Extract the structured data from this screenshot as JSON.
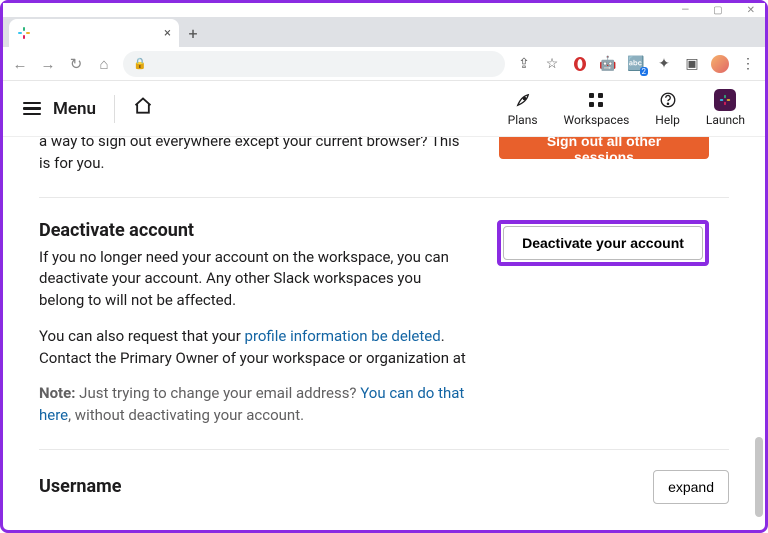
{
  "window": {
    "min_icon": "—",
    "max_icon": "▢",
    "close_icon": "✕"
  },
  "browser": {
    "tab_title": "",
    "new_tab_icon": "+",
    "nav_back": "←",
    "nav_fwd": "→",
    "nav_reload": "↻",
    "nav_home": "⌂",
    "lock_icon": "🔒",
    "url_text": "",
    "share_icon": "⇪",
    "star_icon": "☆",
    "ext_opera_color": "#d32f2f",
    "ext_face": "🤖",
    "ext_translate": "🔤",
    "ext_translate_badge": "2",
    "ext_puzzle": "✦",
    "ext_window": "▣",
    "menu_dots": "⋮"
  },
  "header": {
    "menu_label": "Menu",
    "nav": {
      "plans": "Plans",
      "workspaces": "Workspaces",
      "help": "Help",
      "launch": "Launch"
    }
  },
  "sections": {
    "signout": {
      "partial_text": "a way to sign out everywhere except your current browser? This is for you.",
      "button_label": "Sign out all other sessions"
    },
    "deactivate": {
      "title": "Deactivate account",
      "p1_a": "If you no longer need your account on the ",
      "p1_b": " workspace, you can deactivate your account. Any other Slack workspaces you belong to will not be affected.",
      "p2_a": "You can also request that your ",
      "p2_link": "profile information be deleted",
      "p2_b": ". Contact the Primary Owner of your workspace or organization at ",
      "note_label": "Note:",
      "note_a": " Just trying to change your email address? ",
      "note_link": "You can do that here",
      "note_b": ", without deactivating your account.",
      "button_label": "Deactivate your account"
    },
    "username": {
      "title": "Username",
      "expand_label": "expand"
    }
  }
}
